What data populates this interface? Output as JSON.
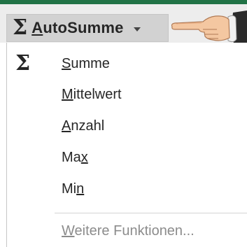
{
  "toolbar": {
    "sigma_glyph": "Σ",
    "autosum_label_first": "A",
    "autosum_label_rest": "utoSumme",
    "accent_color": "#217346"
  },
  "menu": {
    "items": [
      {
        "icon": "Σ",
        "key": "S",
        "rest": "umme",
        "pre": "",
        "disabled": false
      },
      {
        "icon": "",
        "key": "M",
        "rest": "ittelwert",
        "pre": "",
        "disabled": false
      },
      {
        "icon": "",
        "key": "A",
        "rest": "nzahl",
        "pre": "",
        "disabled": false
      },
      {
        "icon": "",
        "key": "x",
        "rest": "",
        "pre": "Ma",
        "disabled": false
      },
      {
        "icon": "",
        "key": "n",
        "rest": "",
        "pre": "Mi",
        "disabled": false
      },
      {
        "icon": "",
        "key": "W",
        "rest": "eitere Funktionen...",
        "pre": "",
        "disabled": true
      }
    ]
  },
  "icons": {
    "autosum": "sigma-icon",
    "pointer": "hand-pointer-icon",
    "dropdown": "dropdown-arrow-icon"
  }
}
